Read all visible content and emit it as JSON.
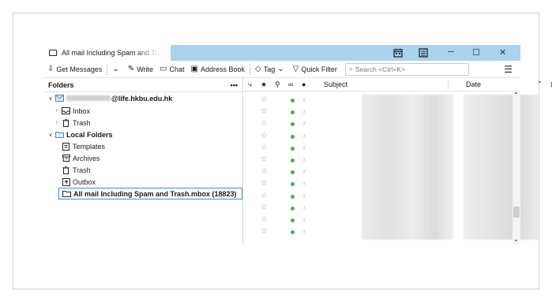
{
  "window": {
    "tab_title": "All mail Including Spam and Trash",
    "controls": {
      "minimize": "─",
      "maximize": "☐",
      "close": "✕"
    }
  },
  "toolbar": {
    "get_messages": "Get Messages",
    "write": "Write",
    "chat": "Chat",
    "address_book": "Address Book",
    "tag": "Tag",
    "quick_filter": "Quick Filter",
    "search_placeholder": "Search <Ctrl+K>"
  },
  "folders": {
    "header": "Folders",
    "more": "•••",
    "account": "@life.hkbu.edu.hk",
    "inbox": "Inbox",
    "trash": "Trash",
    "local_folders": "Local Folders",
    "templates": "Templates",
    "archives": "Archives",
    "local_trash": "Trash",
    "outbox": "Outbox",
    "selected_mbox": "All mail Including Spam and Trash.mbox (18823)"
  },
  "columns": {
    "subject": "Subject",
    "date": "Date"
  },
  "colors": {
    "titlebar": "#a9d3ef",
    "unread_dot": "#4caf50",
    "selection_border": "#3b8fd4"
  },
  "message_row_count": 12
}
